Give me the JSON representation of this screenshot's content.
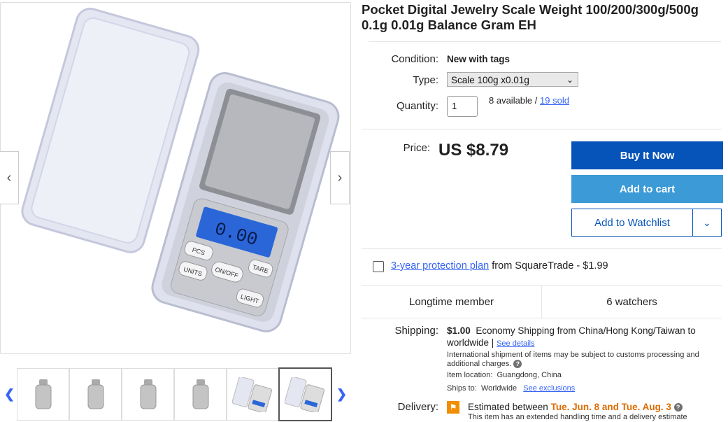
{
  "title": "Pocket Digital Jewelry Scale Weight 100/200/300g/500g 0.1g 0.01g Balance Gram EH",
  "gallery": {
    "prev_icon": "chevron-left-icon",
    "next_icon": "chevron-right-icon",
    "prev_glyph": "‹",
    "next_glyph": "›",
    "thumb_prev_glyph": "❮",
    "thumb_next_glyph": "❯",
    "scale_display": "0.00",
    "buttons": [
      "PCS",
      "UNITS",
      "ON/OFF",
      "TARE",
      "LIGHT"
    ]
  },
  "condition": {
    "label": "Condition:",
    "value": "New with tags"
  },
  "type": {
    "label": "Type:",
    "value": "Scale 100g x0.01g"
  },
  "quantity": {
    "label": "Quantity:",
    "value": "1",
    "available": "8 available /",
    "sold": "19 sold"
  },
  "price": {
    "label": "Price:",
    "value": "US $8.79"
  },
  "buttons": {
    "buy": "Buy It Now",
    "cart": "Add to cart",
    "watch": "Add to Watchlist"
  },
  "protection": {
    "link": "3-year protection plan",
    "text": "from SquareTrade - $1.99"
  },
  "stats": {
    "member": "Longtime member",
    "watchers": "6 watchers"
  },
  "shipping": {
    "label": "Shipping:",
    "price": "$1.00",
    "method": "Economy Shipping from China/Hong Kong/Taiwan to worldwide",
    "sep": "|",
    "details_link": "See details",
    "customs": "International shipment of items may be subject to customs processing and additional charges.",
    "location_label": "Item location:",
    "location": "Guangdong, China",
    "ships_label": "Ships to:",
    "ships_to": "Worldwide",
    "exclusions_link": "See exclusions"
  },
  "delivery": {
    "label": "Delivery:",
    "prefix": "Estimated between",
    "dates": "Tue. Jun. 8 and Tue. Aug. 3",
    "note": "This item has an extended handling time and a delivery estimate"
  },
  "colors": {
    "primary": "#0654ba",
    "cart": "#3c9ad6",
    "link": "#3665f3",
    "delivery": "#dd6b00"
  }
}
